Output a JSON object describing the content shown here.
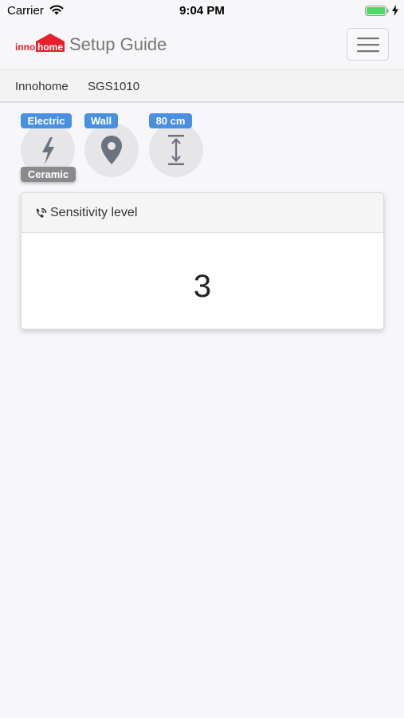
{
  "status_bar": {
    "carrier": "Carrier",
    "time": "9:04 PM",
    "icons": [
      "wifi-icon",
      "battery-icon",
      "charging-bolt-icon"
    ],
    "battery_level": 1.0,
    "battery_color": "#4cd964"
  },
  "header": {
    "logo": {
      "text_left": "inno",
      "text_right": "home",
      "color": "#e8202a"
    },
    "title": "Setup Guide",
    "menu_icon": "hamburger-menu-icon"
  },
  "breadcrumb": {
    "brand": "Innohome",
    "model": "SGS1010"
  },
  "options": {
    "power": {
      "icon": "lightning-bolt-icon",
      "badge": "Electric",
      "secondary_badge": "Ceramic"
    },
    "location": {
      "icon": "map-pin-icon",
      "badge": "Wall"
    },
    "height": {
      "icon": "vertical-measure-icon",
      "badge": "80 cm"
    }
  },
  "colors": {
    "badge_blue": "#4a90e2",
    "badge_gray": "#8a8a8c",
    "icon_gray": "#6b7380"
  },
  "card": {
    "icon": "signal-icon",
    "title": "Sensitivity level",
    "value": "3"
  }
}
